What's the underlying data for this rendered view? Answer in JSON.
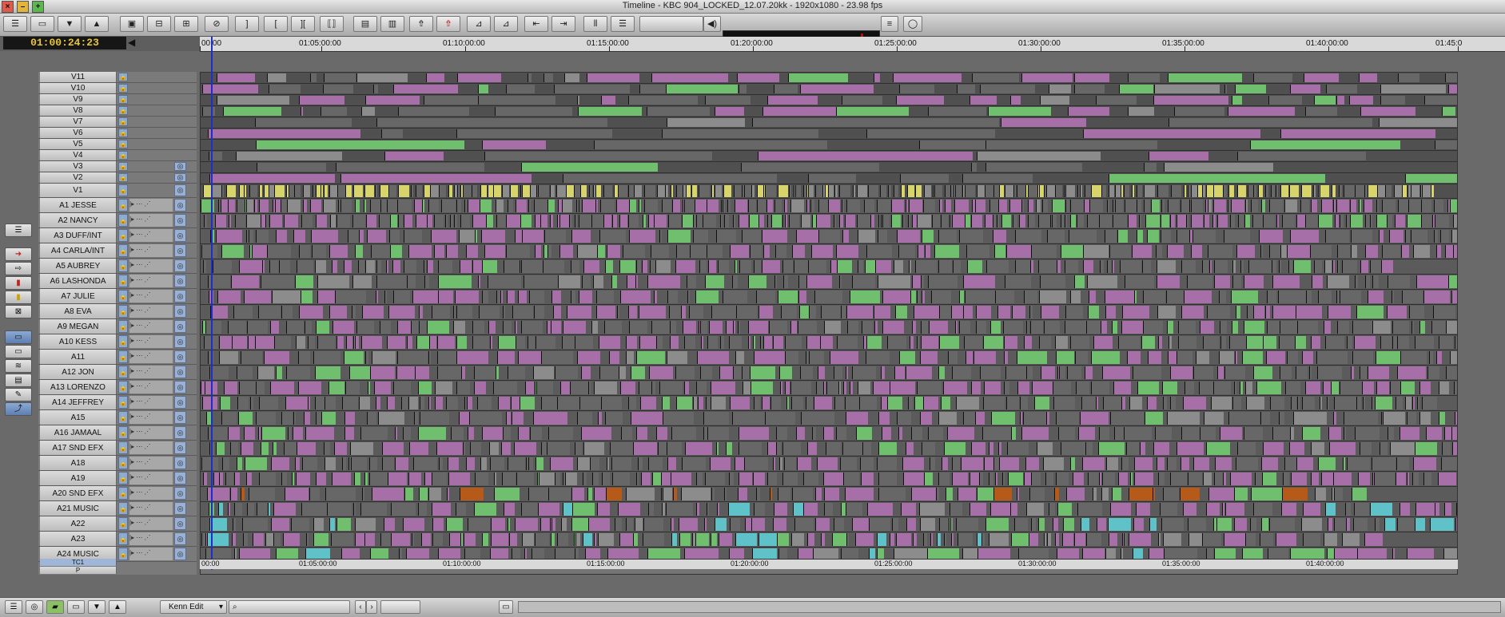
{
  "window": {
    "title": "Timeline - KBC 904_LOCKED_12.07.20kk - 1920x1080 - 23.98 fps"
  },
  "timecode": "01:00:24:23",
  "ruler": {
    "labels": [
      "00:00",
      "01:05:00:00",
      "01:10:00:00",
      "01:15:00:00",
      "01:20:00:00",
      "01:25:00:00",
      "01:30:00:00",
      "01:35:00:00",
      "01:40:00:00",
      "01:45:0"
    ],
    "bottom_labels": [
      "00:00",
      "01:05:00:00",
      "01:10:00:00",
      "01:15:00:00",
      "01:20:00:00",
      "01:25:00:00",
      "01:30:00:00",
      "01:35:00:00",
      "01:40:00:00"
    ]
  },
  "tracks": {
    "video": [
      "V11",
      "V10",
      "V9",
      "V8",
      "V7",
      "V6",
      "V5",
      "V4",
      "V3",
      "V2",
      "V1"
    ],
    "audio": [
      "A1 JESSE",
      "A2 NANCY",
      "A3 DUFF/INT",
      "A4 CARLA/INT",
      "A5 AUBREY",
      "A6 LASHONDA",
      "A7 JULIE",
      "A8 EVA",
      "A9 MEGAN",
      "A10 KESS",
      "A11",
      "A12 JON",
      "A13 LORENZO",
      "A14 JEFFREY",
      "A15",
      "A16 JAMAAL",
      "A17 SND EFX",
      "A18",
      "A19",
      "A20 SND EFX",
      "A21 MUSIC",
      "A22",
      "A23",
      "A24 MUSIC"
    ],
    "timecode_track": "TC1",
    "p_track": "P"
  },
  "status": {
    "workspace": "Kenn Edit"
  },
  "colors": {
    "playhead": "#1e2ec8",
    "timecode_text": "#e8c43a",
    "lock_blue": "#8fa9cf"
  }
}
